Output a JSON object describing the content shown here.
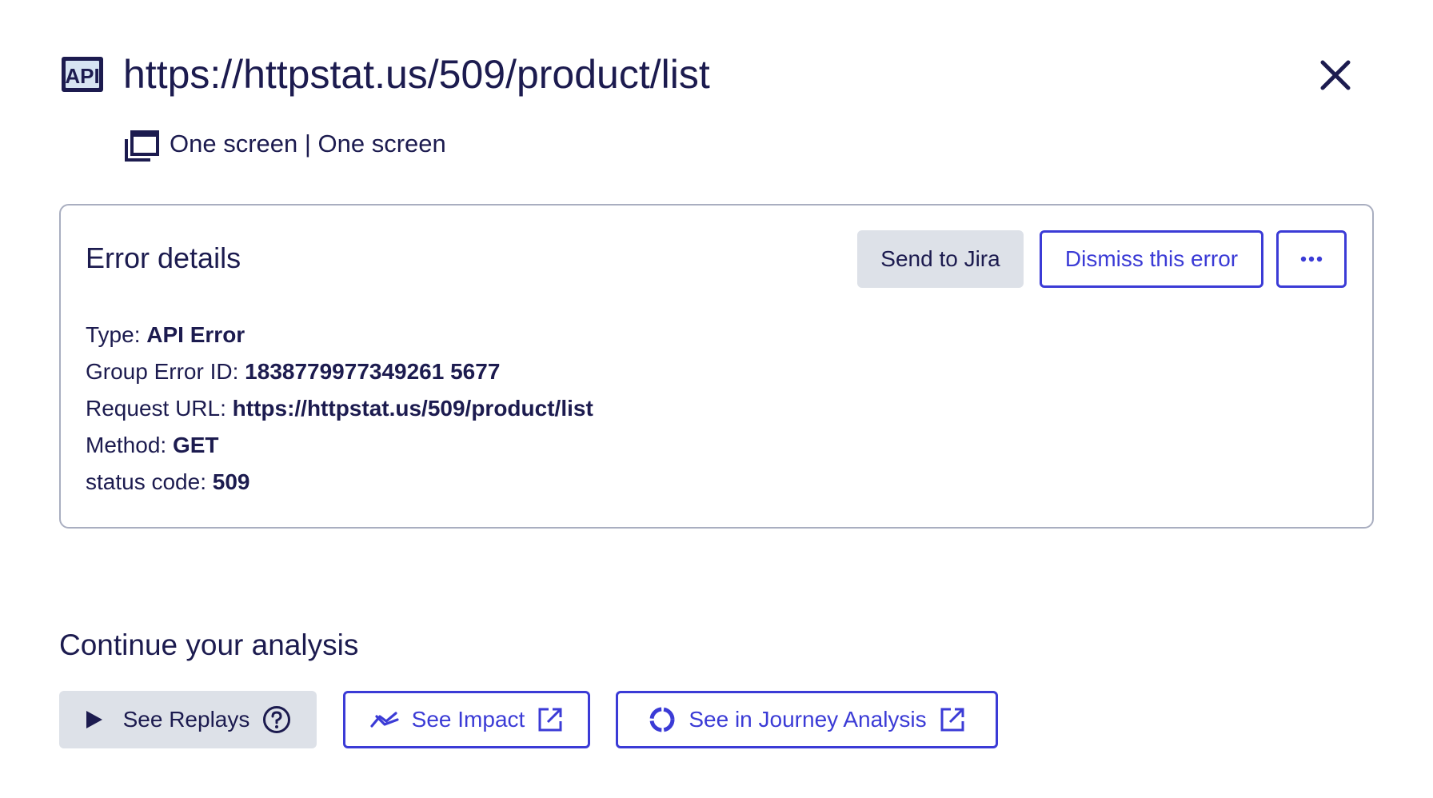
{
  "header": {
    "title": "https://httpstat.us/509/product/list",
    "api_icon_label": "API",
    "api_icon": "api-icon",
    "close_icon": "close-icon",
    "screens_icon": "screens-icon",
    "screens_text": "One screen | One screen"
  },
  "card": {
    "title": "Error details",
    "send_to_jira_label": "Send to Jira",
    "dismiss_label": "Dismiss this error",
    "more_icon": "more-icon",
    "details": [
      {
        "label": "Type: ",
        "value": "API Error"
      },
      {
        "label": "Group Error ID: ",
        "value": "1838779977349261 5677"
      },
      {
        "label": "Request URL: ",
        "value": "https://httpstat.us/509/product/list"
      },
      {
        "label": "Method: ",
        "value": "GET"
      },
      {
        "label": "status code: ",
        "value": "509"
      }
    ]
  },
  "analysis": {
    "title": "Continue your analysis",
    "replays_label": "See Replays",
    "replays_icons": [
      "play-icon",
      "help-icon"
    ],
    "impact_label": "See Impact",
    "impact_icons": [
      "trend-icon",
      "external-link-icon"
    ],
    "journey_label": "See in Journey Analysis",
    "journey_icons": [
      "donut-icon",
      "external-link-icon"
    ]
  },
  "colors": {
    "text": "#1c1b4f",
    "accent": "#3b3bd6",
    "gray_button": "#dde1e8",
    "card_border": "#a9aec0"
  }
}
